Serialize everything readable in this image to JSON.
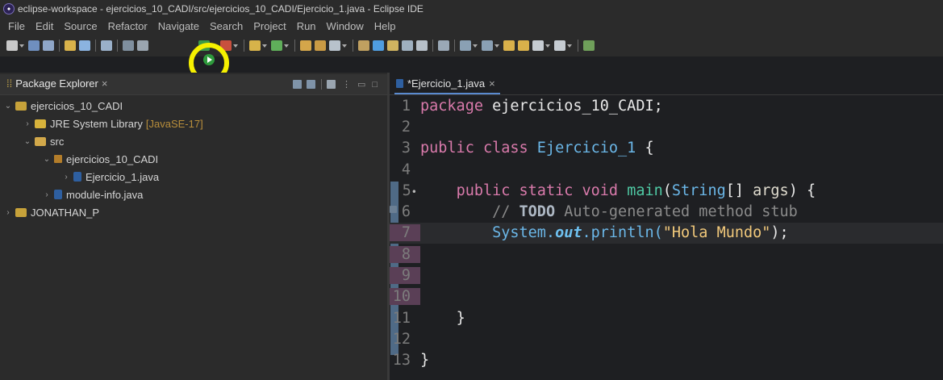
{
  "window": {
    "title": "eclipse-workspace - ejercicios_10_CADI/src/ejercicios_10_CADI/Ejercicio_1.java - Eclipse IDE"
  },
  "menu": [
    "File",
    "Edit",
    "Source",
    "Refactor",
    "Navigate",
    "Search",
    "Project",
    "Run",
    "Window",
    "Help"
  ],
  "colors": {
    "highlight": "#f6f000",
    "run": "#2e9a3c"
  },
  "package_explorer": {
    "tab_label": "Package Explorer",
    "tree": [
      {
        "label": "ejercicios_10_CADI"
      },
      {
        "label": "JRE System Library",
        "suffix": "[JavaSE-17]"
      },
      {
        "label": "src"
      },
      {
        "label": "ejercicios_10_CADI"
      },
      {
        "label": "Ejercicio_1.java"
      },
      {
        "label": "module-info.java"
      },
      {
        "label": "JONATHAN_P"
      }
    ]
  },
  "editor": {
    "tab_label": "*Ejercicio_1.java",
    "lines": {
      "n": [
        "1",
        "2",
        "3",
        "4",
        "5",
        "6",
        "7",
        "8",
        "9",
        "10",
        "11",
        "12",
        "13"
      ],
      "l1_kw": "package",
      "l1_rest": " ejercicios_10_CADI;",
      "l3_kw": "public class",
      "l3_cls": "Ejercicio_1",
      "l3_rest": " {",
      "l5_kw": "public static void",
      "l5_fn": "main",
      "l5_p1": "(",
      "l5_cls": "String",
      "l5_p2": "[] ",
      "l5_args": "args",
      "l5_p3": ") {",
      "l6_c1": "// ",
      "l6_todo": "TODO",
      "l6_c2": " Auto-generated method stub",
      "l7_sys": "System.",
      "l7_out": "out",
      "l7_print": ".println(",
      "l7_str": "\"Hola Mundo\"",
      "l7_end": ");",
      "l11": "}",
      "l13": "}",
      "l5_marker": "•"
    }
  }
}
